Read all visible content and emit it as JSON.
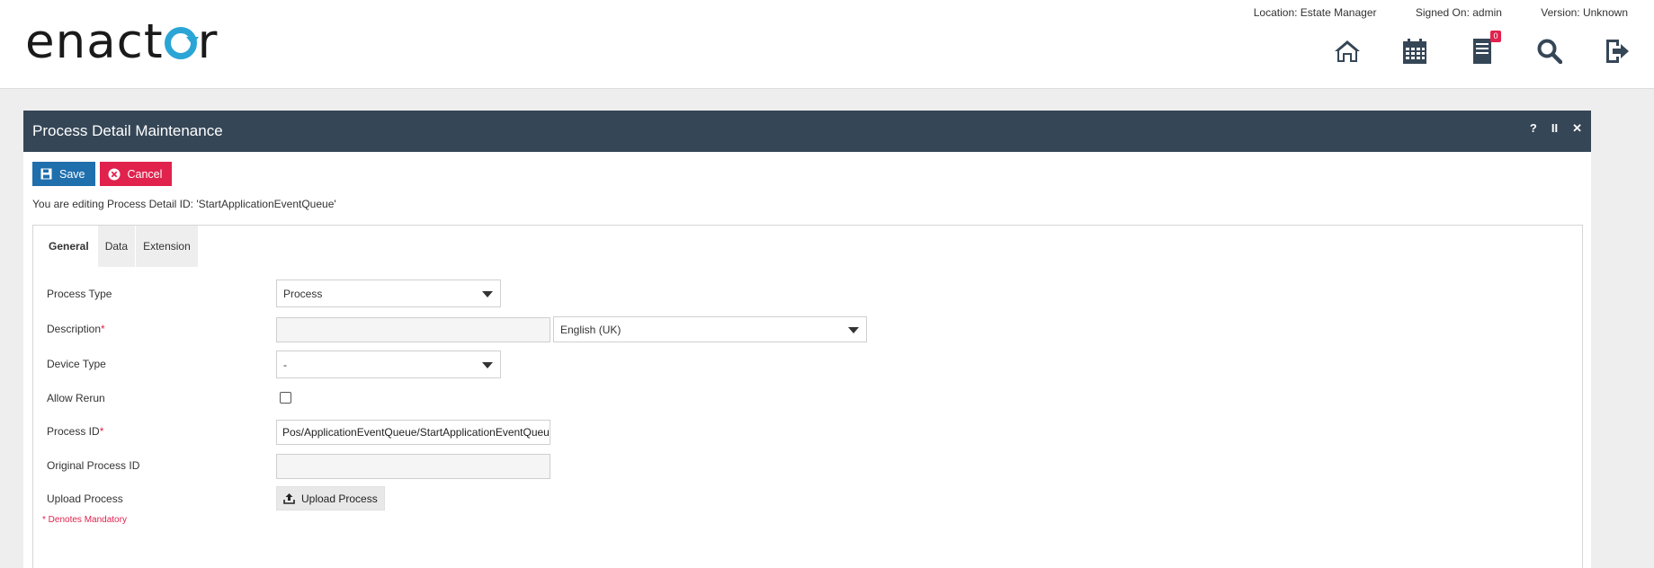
{
  "header": {
    "logo_text": "enactor",
    "location": "Location: Estate Manager",
    "signed_on": "Signed On: admin",
    "version": "Version: Unknown",
    "icons": [
      "home-icon",
      "calendar-icon",
      "document-icon",
      "search-icon",
      "logout-icon"
    ],
    "notification_count": "0"
  },
  "panel": {
    "title": "Process Detail Maintenance",
    "help": "?",
    "pause": "II",
    "close": "✕",
    "save_label": "Save",
    "cancel_label": "Cancel",
    "editing_message": "You are editing Process Detail ID: 'StartApplicationEventQueue'"
  },
  "tabs": [
    {
      "label": "General",
      "active": true
    },
    {
      "label": "Data",
      "active": false
    },
    {
      "label": "Extension",
      "active": false
    }
  ],
  "form": {
    "process_type": {
      "label": "Process Type",
      "value": "Process"
    },
    "description": {
      "label": "Description",
      "required_mark": "*",
      "value": "",
      "language": "English (UK)"
    },
    "device_type": {
      "label": "Device Type",
      "value": "-"
    },
    "allow_rerun": {
      "label": "Allow Rerun",
      "checked": false
    },
    "process_id": {
      "label": "Process ID",
      "required_mark": "*",
      "value": "Pos/ApplicationEventQueue/StartApplicationEventQueue"
    },
    "original_process_id": {
      "label": "Original Process ID",
      "value": ""
    },
    "upload_process": {
      "label": "Upload Process",
      "button_label": "Upload Process"
    },
    "mandatory_note": "* Denotes Mandatory"
  },
  "colors": {
    "header_bar": "#354656",
    "save_button": "#1f6fad",
    "cancel_button": "#e0224d",
    "logo_accent": "#2aa5d6",
    "required": "#e0224d"
  }
}
